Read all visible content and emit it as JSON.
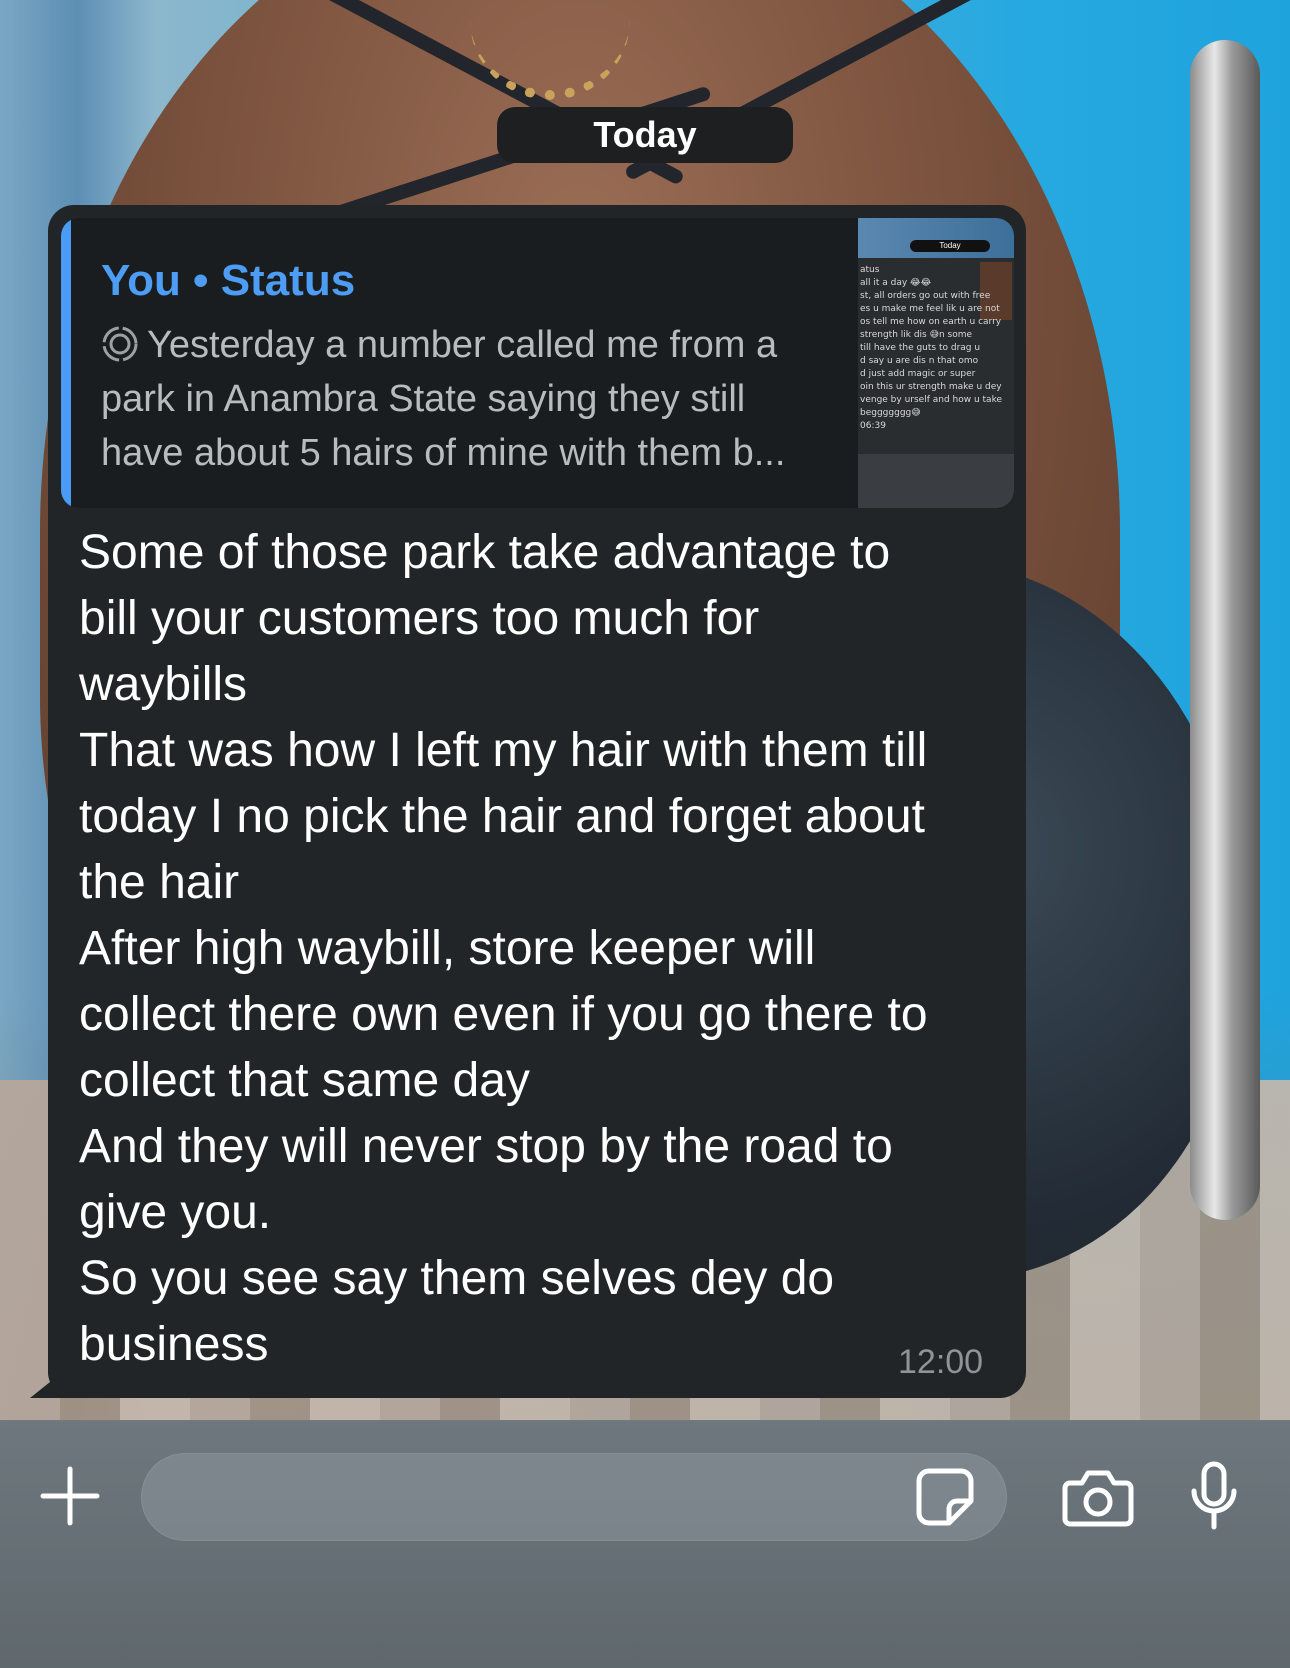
{
  "date_separator": "Today",
  "message": {
    "quote": {
      "author": "You • Status",
      "text": "Yesterday a number called me from a park in Anambra State saying they still have about 5 hairs of mine with them b...",
      "status_icon": "status-ring-icon"
    },
    "thumbnail": {
      "date": "Today",
      "lines": [
        "atus",
        "all it a day 😂😂",
        "st, all orders go out with free",
        "es u make me feel lik u are not",
        "os tell me how on earth u carry",
        "strength lik dis 😅n some",
        "till have the guts to drag u",
        "d say u are dis n that omo",
        "d just add magic or super",
        "oin this ur strength make u dey",
        "venge by urself and how u take",
        "beggggggg😅",
        "06:39"
      ]
    },
    "body": "Some of those park take advantage to\nbill your customers too much for\nwaybills\nThat was how I left my hair with them till\ntoday I no pick the hair and forget about\nthe hair\nAfter high waybill, store keeper will\ncollect there own even if you go there to\ncollect that same day\nAnd they will never stop by the road to\ngive you.\nSo you see say them selves dey do\nbusiness",
    "time": "12:00"
  },
  "input_bar": {
    "placeholder": "",
    "icons": [
      "plus-icon",
      "sticker-icon",
      "camera-icon",
      "microphone-icon"
    ]
  },
  "colors": {
    "bubble": "#222527",
    "quote_accent": "#4a9bf5",
    "quote_author": "#4c9df3",
    "date_pill": "#1d1f21"
  }
}
